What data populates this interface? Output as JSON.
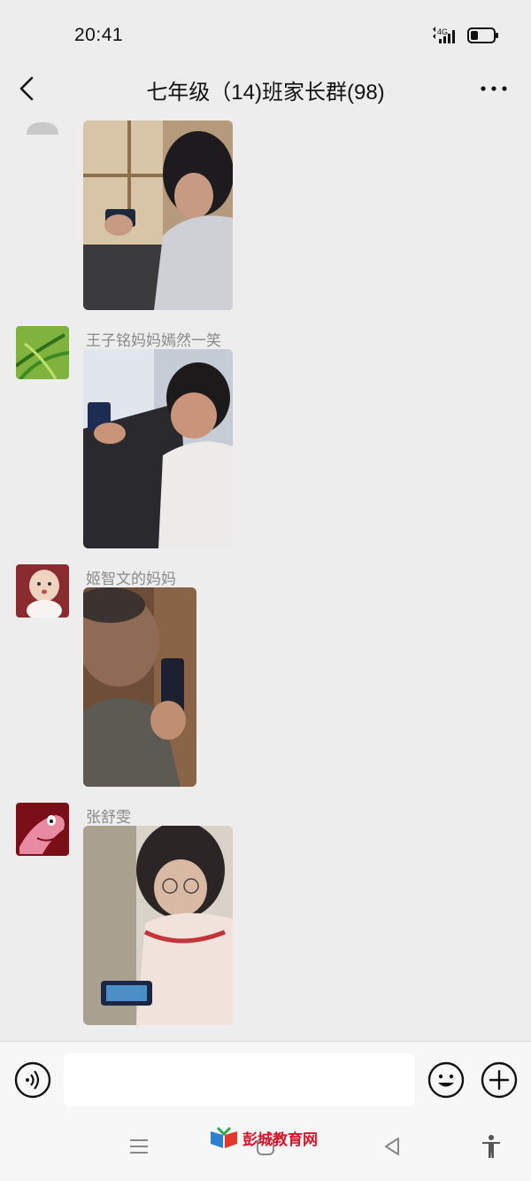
{
  "status_bar": {
    "time": "20:41",
    "network": "4G"
  },
  "header": {
    "title": "七年级（14)班家长群(98)"
  },
  "messages": [
    {
      "sender": "",
      "avatar": "blank-avatar",
      "content_type": "image"
    },
    {
      "sender": "王子铭妈妈嫣然一笑",
      "avatar": "grass-avatar",
      "content_type": "image"
    },
    {
      "sender": "姬智文的妈妈",
      "avatar": "baby-avatar",
      "content_type": "image"
    },
    {
      "sender": "张舒雯",
      "avatar": "patrick-star-avatar",
      "content_type": "image"
    }
  ],
  "input_bar": {
    "text_value": ""
  },
  "watermark": {
    "text": "彭城教育网"
  },
  "colors": {
    "background": "#ededed",
    "bar": "#f7f7f7",
    "sender_text": "#8a8a8a",
    "watermark": "#d8142a"
  }
}
